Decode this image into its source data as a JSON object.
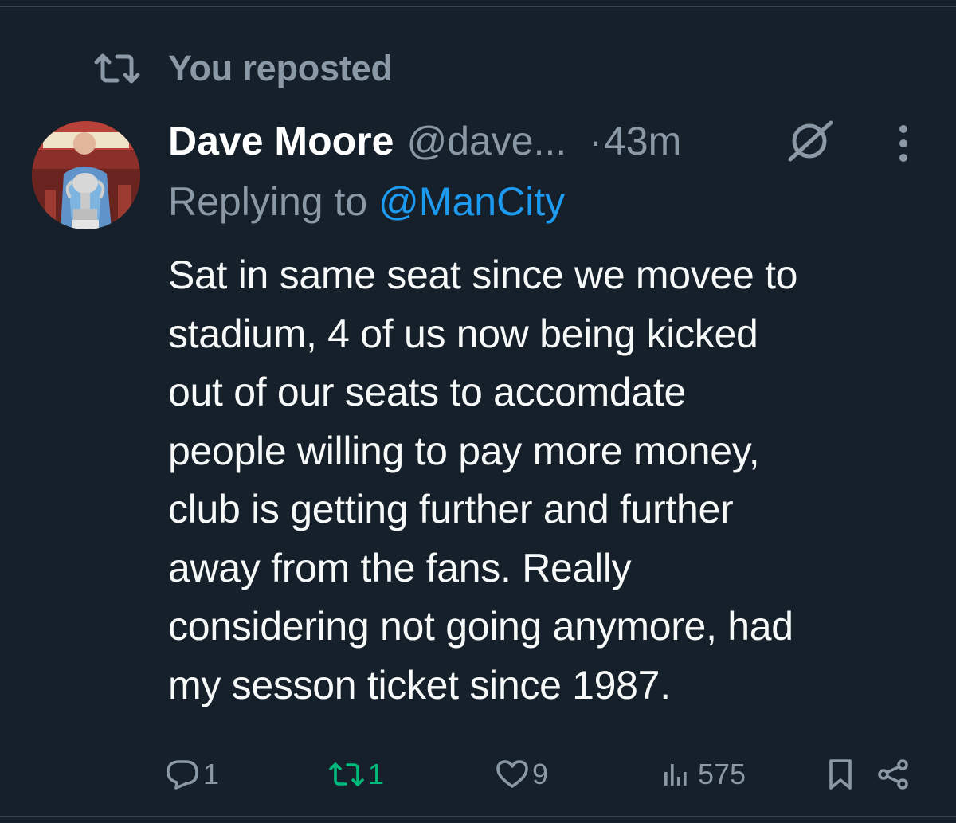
{
  "repost_banner": {
    "text": "You reposted"
  },
  "tweet": {
    "author": {
      "display_name": "Dave Moore",
      "handle": "@dave..."
    },
    "separator": "·",
    "time_ago": "43m",
    "reply_prefix": "Replying to ",
    "reply_to": "@ManCity",
    "body": "Sat in same seat since we movee to\nstadium, 4 of us now being kicked\nout of our seats to accomdate\npeople willing to pay more money,\nclub is getting further and further\naway from the fans. Really\nconsidering not going anymore, had\nmy sesson ticket since 1987."
  },
  "actions": {
    "replies": "1",
    "reposts": "1",
    "likes": "9",
    "views": "575"
  },
  "icons": {
    "repost": "repost-icon",
    "edit": "edited-icon",
    "more": "more-icon",
    "reply": "reply-icon",
    "like": "heart-icon",
    "views": "views-icon",
    "bookmark": "bookmark-icon",
    "share": "share-icon"
  },
  "colors": {
    "background": "#15202b",
    "primary_text": "#f7f9f9",
    "secondary_text": "#8b98a5",
    "link": "#1d9bf0",
    "reposted_green": "#00ba7c",
    "divider": "#38444d"
  }
}
